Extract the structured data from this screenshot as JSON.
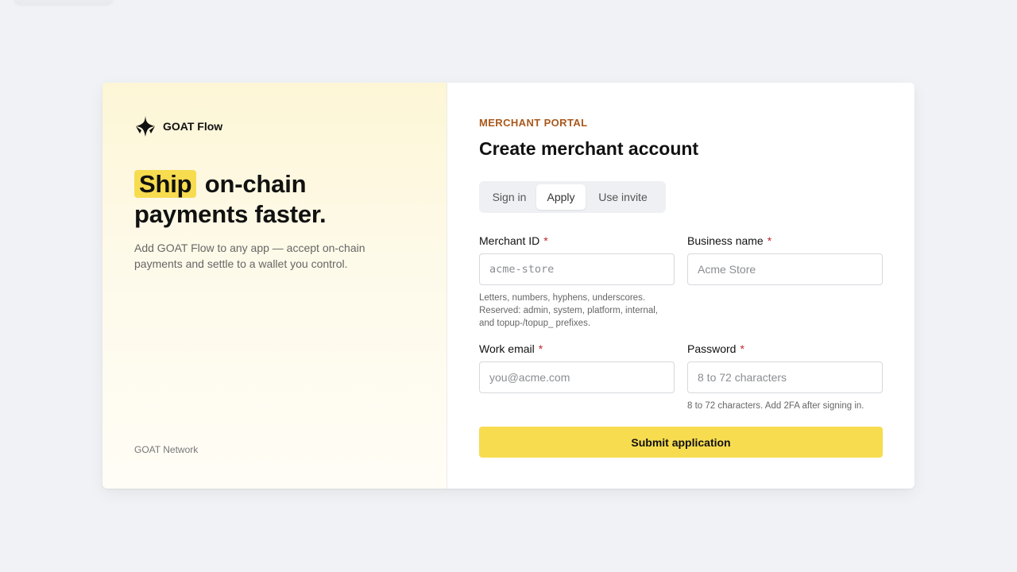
{
  "brand": {
    "name": "GOAT Flow",
    "icon": "sparkle-logo-icon"
  },
  "hero": {
    "highlight": "Ship",
    "headline_rest": "on-chain payments faster.",
    "tagline": "Add GOAT Flow to any app — accept on-chain payments and settle to a wallet you control."
  },
  "footer": {
    "text": "GOAT Network"
  },
  "form": {
    "eyebrow": "MERCHANT PORTAL",
    "title": "Create merchant account",
    "tabs": [
      {
        "label": "Sign in",
        "active": false
      },
      {
        "label": "Apply",
        "active": true
      },
      {
        "label": "Use invite",
        "active": false
      }
    ],
    "fields": {
      "merchant_id": {
        "label": "Merchant ID",
        "required": "*",
        "placeholder": "acme-store",
        "value": "",
        "help": "Letters, numbers, hyphens, underscores. Reserved: admin, system, platform, internal, and topup-/topup_ prefixes."
      },
      "business_name": {
        "label": "Business name",
        "required": "*",
        "placeholder": "Acme Store",
        "value": ""
      },
      "work_email": {
        "label": "Work email",
        "required": "*",
        "placeholder": "you@acme.com",
        "value": ""
      },
      "password": {
        "label": "Password",
        "required": "*",
        "placeholder": "8 to 72 characters",
        "value": "",
        "help": "8 to 72 characters. Add 2FA after signing in."
      }
    },
    "submit_label": "Submit application"
  },
  "colors": {
    "accent": "#f7dc4f",
    "eyebrow": "#a9581b",
    "required": "#c0262d",
    "background": "#f0f2f5"
  }
}
